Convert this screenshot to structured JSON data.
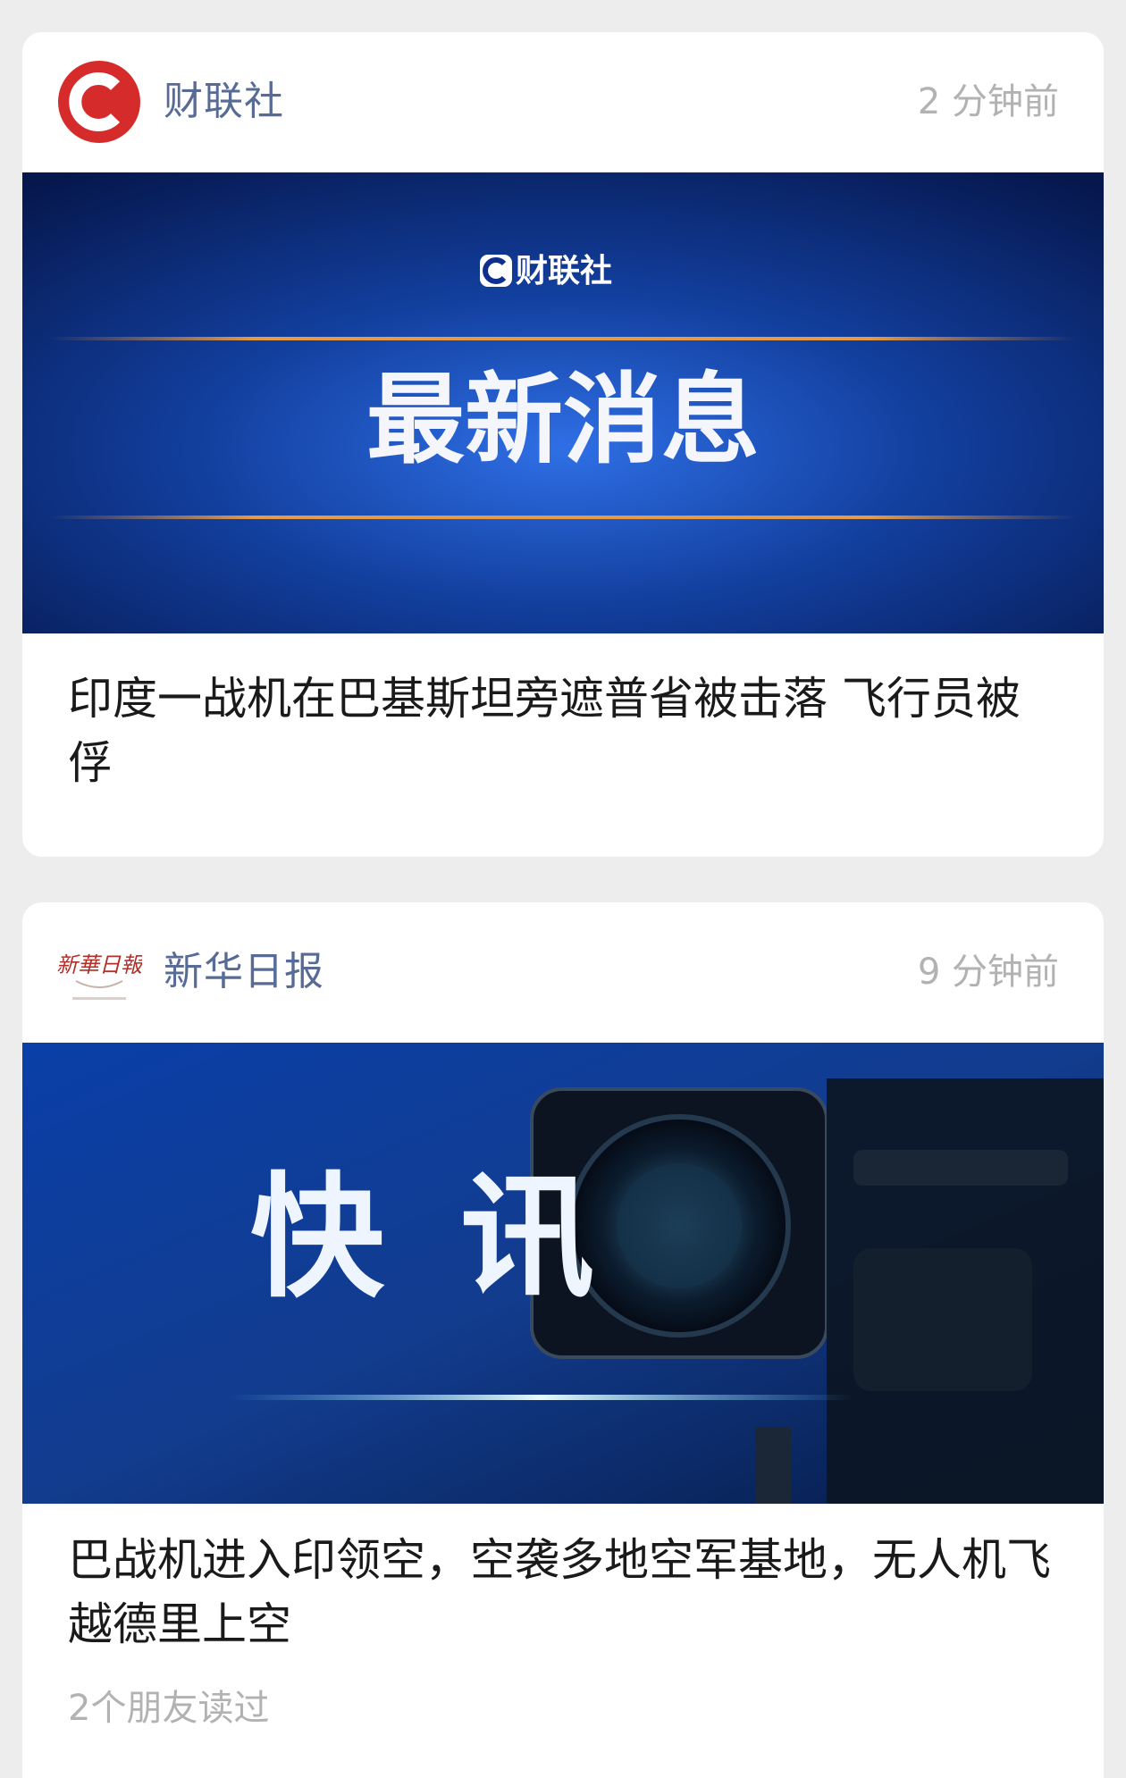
{
  "feed": [
    {
      "source": "财联社",
      "time": "2 分钟前",
      "banner": {
        "brand": "财联社",
        "title": "最新消息"
      },
      "headline": "印度一战机在巴基斯坦旁遮普省被击落 飞行员被俘",
      "logo_icon": "cailianshe-c-logo",
      "accent": "#d62b2b"
    },
    {
      "source": "新华日报",
      "time": "9 分钟前",
      "banner": {
        "title_left": "快",
        "title_right": "讯"
      },
      "headline": "巴战机进入印领空，空袭多地空军基地，无人机飞越德里上空",
      "read_info": "2个朋友读过",
      "logo_text": "新華日報",
      "logo_icon": "xinhua-daily-calligraphy-logo",
      "accent": "#b0302a"
    }
  ],
  "colors": {
    "source_name": "#576b95",
    "meta": "#b2b2b2",
    "page_bg": "#ededed",
    "banner_blue": "#0d2f8f"
  }
}
